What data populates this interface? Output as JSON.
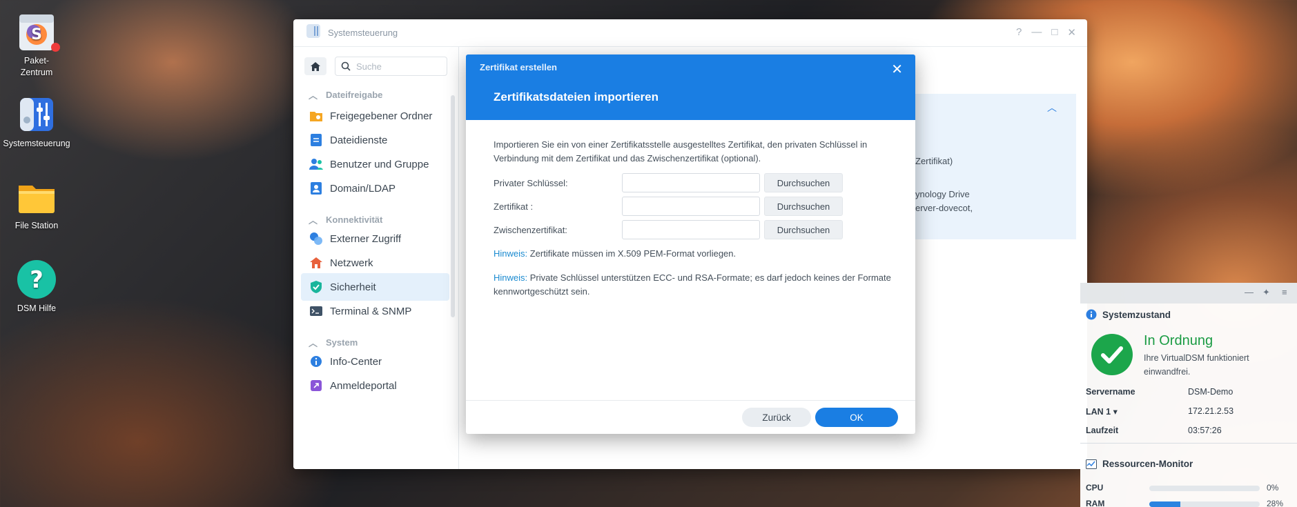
{
  "desktop": {
    "icons": [
      {
        "label": "Paket-\nZentrum",
        "icon": "package-center-icon"
      },
      {
        "label": "Systemsteuerung",
        "icon": "control-panel-icon"
      },
      {
        "label": "File Station",
        "icon": "folder-icon"
      },
      {
        "label": "DSM Hilfe",
        "icon": "help-icon"
      }
    ],
    "pkg_line1": "Paket-",
    "pkg_line2": "Zentrum"
  },
  "window": {
    "title": "Systemsteuerung",
    "controls": {
      "help": "?",
      "minimize": "—",
      "maximize": "□",
      "close": "✕"
    }
  },
  "sidebar": {
    "search_placeholder": "Suche",
    "sections": [
      {
        "label": "Dateifreigabe",
        "items": [
          "Freigegebener Ordner",
          "Dateidienste",
          "Benutzer und Gruppe",
          "Domain/LDAP"
        ]
      },
      {
        "label": "Konnektivität",
        "items": [
          "Externer Zugriff",
          "Netzwerk",
          "Sicherheit",
          "Terminal & SNMP"
        ]
      },
      {
        "label": "System",
        "items": [
          "Info-Center",
          "Anmeldeportal"
        ]
      }
    ],
    "active_item": "Sicherheit"
  },
  "background_panel": {
    "line1": "Zertifikat)",
    "line2": "ynology Drive",
    "line3": "erver-dovecot,"
  },
  "dialog": {
    "header_sub": "Zertifikat erstellen",
    "title": "Zertifikatsdateien importieren",
    "close": "✕",
    "description": "Importieren Sie ein von einer Zertifikatsstelle ausgestelltes Zertifikat, den privaten Schlüssel in Verbindung mit dem Zertifikat und das Zwischenzertifikat (optional).",
    "fields": [
      {
        "label": "Privater Schlüssel:",
        "value": "",
        "button": "Durchsuchen"
      },
      {
        "label": "Zertifikat :",
        "value": "",
        "button": "Durchsuchen"
      },
      {
        "label": "Zwischenzertifikat:",
        "value": "",
        "button": "Durchsuchen"
      }
    ],
    "hints": [
      {
        "prefix": "Hinweis:",
        "text": " Zertifikate müssen im X.509 PEM-Format vorliegen."
      },
      {
        "prefix": "Hinweis:",
        "text": " Private Schlüssel unterstützen ECC- und RSA-Formate; es darf jedoch keines der Formate kennwortgeschützt sein."
      }
    ],
    "back_button": "Zurück",
    "ok_button": "OK"
  },
  "widget": {
    "status_title": "Systemzustand",
    "status": "In Ordnung",
    "status_desc": "Ihre VirtualDSM funktioniert einwandfrei.",
    "info": [
      {
        "key": "Servername",
        "value": "DSM-Demo"
      },
      {
        "key": "LAN 1 ▾",
        "value": "172.21.2.53"
      },
      {
        "key": "Laufzeit",
        "value": "03:57:26"
      }
    ],
    "resource_title": "Ressourcen-Monitor",
    "resources": [
      {
        "label": "CPU",
        "percent": 0,
        "text": "0%"
      },
      {
        "label": "RAM",
        "percent": 28,
        "text": "28%"
      }
    ]
  },
  "colors": {
    "accent": "#1a7ee3",
    "success": "#1ca64b",
    "hint": "#1a8ad0"
  }
}
